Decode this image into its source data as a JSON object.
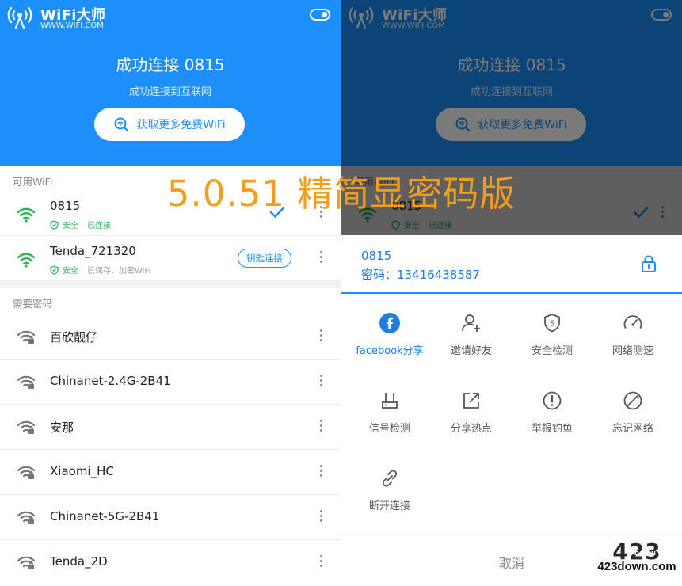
{
  "header": {
    "brand": "WiFi大师",
    "brand_sub": "WWW.WIFI.COM",
    "title": "成功连接 0815",
    "subtitle": "成功连接到互联网",
    "cta_label": "获取更多免费WiFi",
    "brand_color": "#1d8ffa"
  },
  "sections": {
    "available": "可用WiFi",
    "password_required": "需要密码"
  },
  "available_networks": [
    {
      "name": "0815",
      "security": "安全",
      "status": "已连接",
      "extra": ""
    },
    {
      "name": "Tenda_721320",
      "security": "安全",
      "status": "已保存、加密WiFi",
      "extra": "钥匙连接"
    }
  ],
  "locked_networks": [
    {
      "name": "百欣靓仔"
    },
    {
      "name": "Chinanet-2.4G-2B41"
    },
    {
      "name": "安那"
    },
    {
      "name": "Xiaomi_HC"
    },
    {
      "name": "Chinanet-5G-2B41"
    },
    {
      "name": "Tenda_2D"
    }
  ],
  "version_banner": "5.0.51 精简显密码版",
  "sheet": {
    "network_name": "0815",
    "password_line": "密码：13416438587",
    "actions": [
      {
        "label": "facebook分享",
        "icon": "facebook-icon"
      },
      {
        "label": "邀请好友",
        "icon": "add-user-icon"
      },
      {
        "label": "安全检测",
        "icon": "shield-icon"
      },
      {
        "label": "网络测速",
        "icon": "speedometer-icon"
      },
      {
        "label": "信号检测",
        "icon": "router-icon"
      },
      {
        "label": "分享热点",
        "icon": "share-external-icon"
      },
      {
        "label": "举报钓鱼",
        "icon": "alert-icon"
      },
      {
        "label": "忘记网络",
        "icon": "forbidden-icon"
      },
      {
        "label": "断开连接",
        "icon": "unlink-icon"
      }
    ],
    "cancel": "取消"
  },
  "watermark": {
    "number": "423",
    "tag": "DOWN",
    "site": "423down.com"
  }
}
